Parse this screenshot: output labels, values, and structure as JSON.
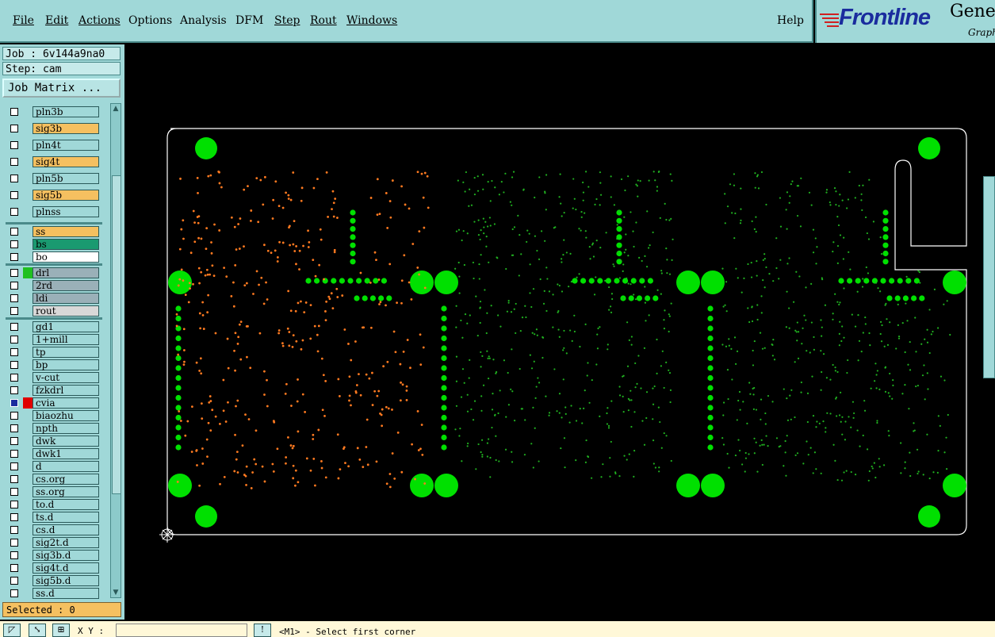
{
  "menu": {
    "file": "File",
    "edit": "Edit",
    "actions": "Actions",
    "options": "Options",
    "analysis": "Analysis",
    "dfm": "DFM",
    "step": "Step",
    "rout": "Rout",
    "windows": "Windows",
    "help": "Help"
  },
  "logo": {
    "brand": "Frontline",
    "product": "Genes",
    "subtitle": "Graph"
  },
  "job": {
    "label": "Job : 6v144a9na0"
  },
  "step": {
    "label": "Step: cam"
  },
  "job_matrix_label": "Job Matrix ...",
  "layers": [
    {
      "name": "pln3b",
      "color": "#a0d8d8"
    },
    {
      "name": "sig3b",
      "color": "#f5c060"
    },
    {
      "name": "pln4t",
      "color": "#a0d8d8"
    },
    {
      "name": "sig4t",
      "color": "#f5c060"
    },
    {
      "name": "pln5b",
      "color": "#a0d8d8"
    },
    {
      "name": "sig5b",
      "color": "#f5c060"
    },
    {
      "name": "plnss",
      "color": "#a0d8d8"
    },
    {
      "name": "ss",
      "color": "#f5c060"
    },
    {
      "name": "bs",
      "color": "#1a9a70"
    },
    {
      "name": "bo",
      "color": "#ffffff"
    },
    {
      "name": "drl",
      "color": "#9ab0b8"
    },
    {
      "name": "2rd",
      "color": "#9ab0b8"
    },
    {
      "name": "ldi",
      "color": "#9ab0b8"
    },
    {
      "name": "rout",
      "color": "#d8d8d8"
    },
    {
      "name": "gd1",
      "color": "#a0d8d8"
    },
    {
      "name": "1+mill",
      "color": "#a0d8d8"
    },
    {
      "name": "tp",
      "color": "#a0d8d8"
    },
    {
      "name": "bp",
      "color": "#a0d8d8"
    },
    {
      "name": "v-cut",
      "color": "#a0d8d8"
    },
    {
      "name": "fzkdrl",
      "color": "#a0d8d8"
    },
    {
      "name": "cvia",
      "color": "#a0d8d8"
    },
    {
      "name": "biaozhu",
      "color": "#a0d8d8"
    },
    {
      "name": "npth",
      "color": "#a0d8d8"
    },
    {
      "name": "dwk",
      "color": "#a0d8d8"
    },
    {
      "name": "dwk1",
      "color": "#a0d8d8"
    },
    {
      "name": "d",
      "color": "#a0d8d8"
    },
    {
      "name": "cs.org",
      "color": "#a0d8d8"
    },
    {
      "name": "ss.org",
      "color": "#a0d8d8"
    },
    {
      "name": "to.d",
      "color": "#a0d8d8"
    },
    {
      "name": "ts.d",
      "color": "#a0d8d8"
    },
    {
      "name": "cs.d",
      "color": "#a0d8d8"
    },
    {
      "name": "sig2t.d",
      "color": "#a0d8d8"
    },
    {
      "name": "sig3b.d",
      "color": "#a0d8d8"
    },
    {
      "name": "sig4t.d",
      "color": "#a0d8d8"
    },
    {
      "name": "sig5b.d",
      "color": "#a0d8d8"
    },
    {
      "name": "ss.d",
      "color": "#a0d8d8"
    }
  ],
  "selected": "Selected : 0",
  "status": {
    "xy_label": "X Y :",
    "message": "<M1> - Select first corner"
  },
  "colors": {
    "panel": "#a0d8d8",
    "outline": "#ffffff",
    "pad_green": "#00e000",
    "pad_orange": "#ff7a20"
  }
}
